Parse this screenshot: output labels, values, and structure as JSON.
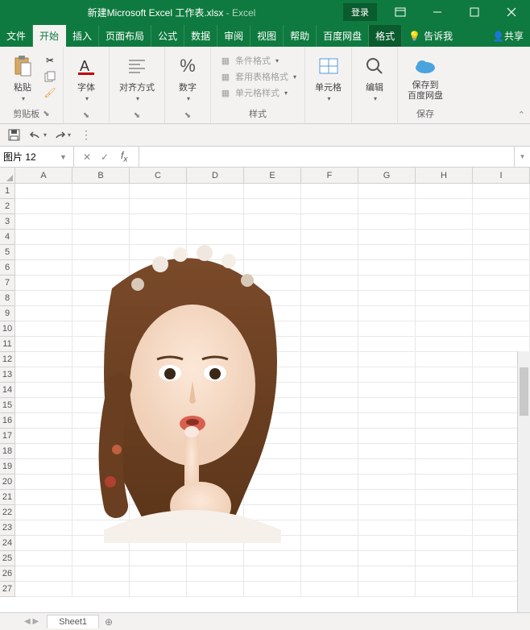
{
  "title": {
    "filename": "新建Microsoft Excel 工作表.xlsx",
    "sep": " - ",
    "app": "Excel",
    "login": "登录"
  },
  "tabs": {
    "file": "文件",
    "home": "开始",
    "insert": "插入",
    "layout": "页面布局",
    "formulas": "公式",
    "data": "数据",
    "review": "审阅",
    "view": "视图",
    "help": "帮助",
    "baidu": "百度网盘",
    "format": "格式",
    "tellme": "告诉我",
    "share": "共享"
  },
  "ribbon": {
    "clipboard": {
      "paste": "粘贴",
      "label": "剪贴板"
    },
    "font": {
      "label": "字体"
    },
    "align": {
      "label": "对齐方式"
    },
    "number": {
      "label": "数字"
    },
    "styles": {
      "cond": "条件格式",
      "table": "套用表格格式",
      "cell": "单元格样式",
      "label": "样式"
    },
    "cells": {
      "btn": "单元格"
    },
    "editing": {
      "btn": "编辑"
    },
    "save": {
      "btn": "保存到\n百度网盘",
      "label": "保存"
    }
  },
  "namebox": "图片 12",
  "columns": [
    "A",
    "B",
    "C",
    "D",
    "E",
    "F",
    "G",
    "H",
    "I"
  ],
  "rows": [
    "1",
    "2",
    "3",
    "4",
    "5",
    "6",
    "7",
    "8",
    "9",
    "10",
    "11",
    "12",
    "13",
    "14",
    "15",
    "16",
    "17",
    "18",
    "19",
    "20",
    "21",
    "22",
    "23",
    "24",
    "25",
    "26",
    "27"
  ],
  "sheet": "Sheet1"
}
